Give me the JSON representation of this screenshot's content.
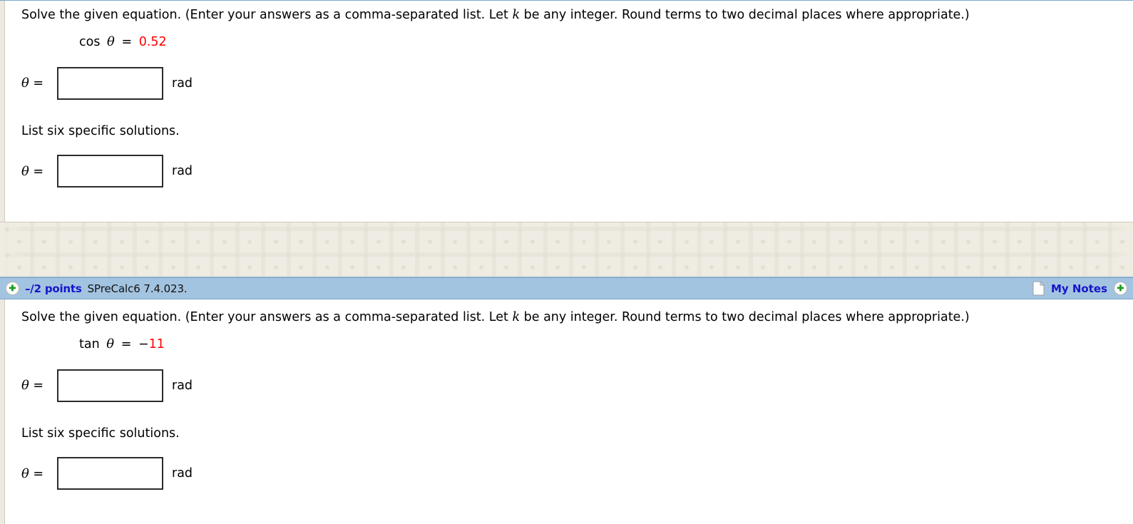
{
  "theme": {
    "header_blue": "#a3c4e0",
    "header_border": "#7ba7cc",
    "link_blue": "#1515cc",
    "value_red": "#ff0000",
    "separator_beige": "#efece3",
    "gutter_beige": "#ece9e1"
  },
  "questions": [
    {
      "prompt": "Solve the given equation. (Enter your answers as a comma-separated list. Let k be any integer. Round terms to two decimal places where appropriate.)",
      "prompt_pre": "Solve the given equation. (Enter your answers as a comma-separated list. Let ",
      "prompt_k": "k",
      "prompt_post": " be any integer. Round terms to two decimal places where appropriate.)",
      "equation": {
        "func": "cos",
        "variable": "θ",
        "equals": "=",
        "sign": "",
        "value": "0.52"
      },
      "answer1": {
        "lhs_var": "θ",
        "lhs_eq": "=",
        "value": "",
        "placeholder": "",
        "unit": "rad"
      },
      "sublabel": "List six specific solutions.",
      "answer2": {
        "lhs_var": "θ",
        "lhs_eq": "=",
        "value": "",
        "placeholder": "",
        "unit": "rad"
      }
    },
    {
      "header": {
        "expand_icon": "plus-circle-icon",
        "points": "–/2 points",
        "assignment_id": "SPreCalc6 7.4.023.",
        "notes_icon": "document-icon",
        "notes_label": "My Notes",
        "add_icon": "plus-circle-icon"
      },
      "prompt_pre": "Solve the given equation. (Enter your answers as a comma-separated list. Let ",
      "prompt_k": "k",
      "prompt_post": " be any integer. Round terms to two decimal places where appropriate.)",
      "equation": {
        "func": "tan",
        "variable": "θ",
        "equals": "=",
        "sign": "−",
        "value": "11"
      },
      "answer1": {
        "lhs_var": "θ",
        "lhs_eq": "=",
        "value": "",
        "placeholder": "",
        "unit": "rad"
      },
      "sublabel": "List six specific solutions.",
      "answer2": {
        "lhs_var": "θ",
        "lhs_eq": "=",
        "value": "",
        "placeholder": "",
        "unit": "rad"
      }
    }
  ]
}
